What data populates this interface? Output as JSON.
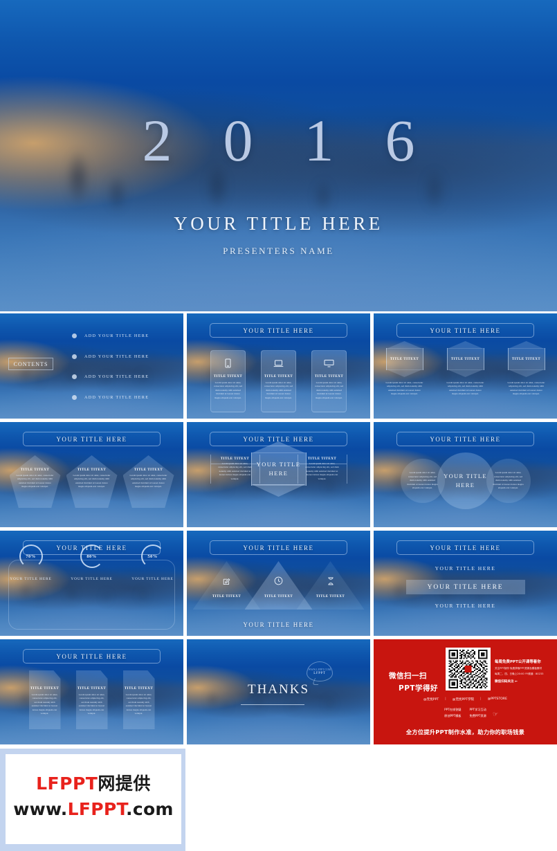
{
  "hero": {
    "year": "2016",
    "title": "YOUR TITLE HERE",
    "subtitle": "PRESENTERS NAME"
  },
  "common": {
    "slide_title": "YOUR TITLE HERE",
    "item_title": "TITLE TITEXT",
    "lorem": "Lorem ipsum dolor sit amet, consectetur adipiscing elit, sed diam nonumy nibh euismod tincidunt ut laoreet dolore magna aliquam erat volutpat."
  },
  "slides": {
    "contents": {
      "label": "CONTENTS",
      "items": [
        "ADD YOUR TITLE HERE",
        "ADD YOUR TITLE HERE",
        "ADD YOUR TITLE HERE",
        "ADD YOUR TITLE HERE"
      ]
    },
    "cards_icons": {
      "title": "YOUR TITLE HERE",
      "cards": [
        {
          "icon": "mobile-phone-icon",
          "title": "TITLE TITEXT"
        },
        {
          "icon": "laptop-icon",
          "title": "TITLE TITEXT"
        },
        {
          "icon": "monitor-icon",
          "title": "TITLE TITEXT"
        }
      ]
    },
    "hexagons": {
      "title": "YOUR TITLE HERE",
      "items": [
        {
          "title": "TITLE TITEXT"
        },
        {
          "title": "TITLE TITEXT"
        },
        {
          "title": "TITLE TITEXT"
        }
      ]
    },
    "pentagons": {
      "title": "YOUR TITLE HERE",
      "items": [
        {
          "title": "TITLE TITEXT"
        },
        {
          "title": "TITLE TITEXT"
        },
        {
          "title": "TITLE TITEXT"
        }
      ]
    },
    "hex_center": {
      "title": "YOUR TITLE HERE",
      "center_label": "YOUR TITLE HERE",
      "items": [
        {
          "title": "TITLE TITEXT"
        },
        {
          "title": "TITLE TITEXT"
        }
      ]
    },
    "venn": {
      "title": "YOUR TITLE HERE",
      "center_label": "YOUR TITLE HERE"
    },
    "donuts": {
      "title": "YOUR TITLE HERE",
      "items": [
        {
          "value": "70%",
          "percent": 70,
          "caption": "YOUR TITLE HERE"
        },
        {
          "value": "80%",
          "percent": 80,
          "caption": "YOUR TITLE HERE"
        },
        {
          "value": "50%",
          "percent": 50,
          "caption": "YOUR TITLE HERE"
        }
      ]
    },
    "triangles": {
      "title": "YOUR TITLE HERE",
      "footer": "YOUR TITLE HERE",
      "items": [
        {
          "icon": "pencil-edit-icon",
          "title": "TITLE TITEXT"
        },
        {
          "icon": "clock-icon",
          "title": "TITLE TITEXT"
        },
        {
          "icon": "hourglass-icon",
          "title": "TITLE TITEXT"
        }
      ]
    },
    "stacked": {
      "title": "YOUR TITLE HERE",
      "lines": [
        "YOUR TITLE HERE",
        "YOUR TITLE HERE",
        "YOUR TITLE HERE"
      ]
    },
    "folded_cards": {
      "title": "YOUR TITLE HERE",
      "items": [
        {
          "title": "TITLE TITEXT"
        },
        {
          "title": "TITLE TITEXT"
        },
        {
          "title": "TITLE TITEXT"
        }
      ]
    },
    "thanks": {
      "label": "THANKS",
      "bubble_url": "WWW.LFPPT.COM",
      "bubble_name": "LFPPT"
    },
    "promo": {
      "headline_line1": "微信扫一扫",
      "headline_line2": "PPT学得好",
      "right_line1": "每周免费PPT公开课等着你",
      "right_line2": "关注PPT制作·免费获取PPT资源及模板素材",
      "right_line3": "每周二、四、日晚上20:00  YY频道：80233",
      "right_line4": "微信扫码关注 ←",
      "handles": [
        "@无忧PPT",
        "@无忧PPT学院",
        "@PPTSTORE"
      ],
      "mini": [
        "PPT在线答疑",
        "PPT学习互动",
        "原创PPT模板",
        "免费PPT资源"
      ],
      "tagline": "全方位提升PPT制作水准，助力你的职场钱景"
    }
  },
  "watermark": {
    "line1_red": "LFPPT",
    "line1_black": "网提供",
    "line2_a": "www.",
    "line2_red": "LFPPT",
    "line2_b": ".com"
  }
}
